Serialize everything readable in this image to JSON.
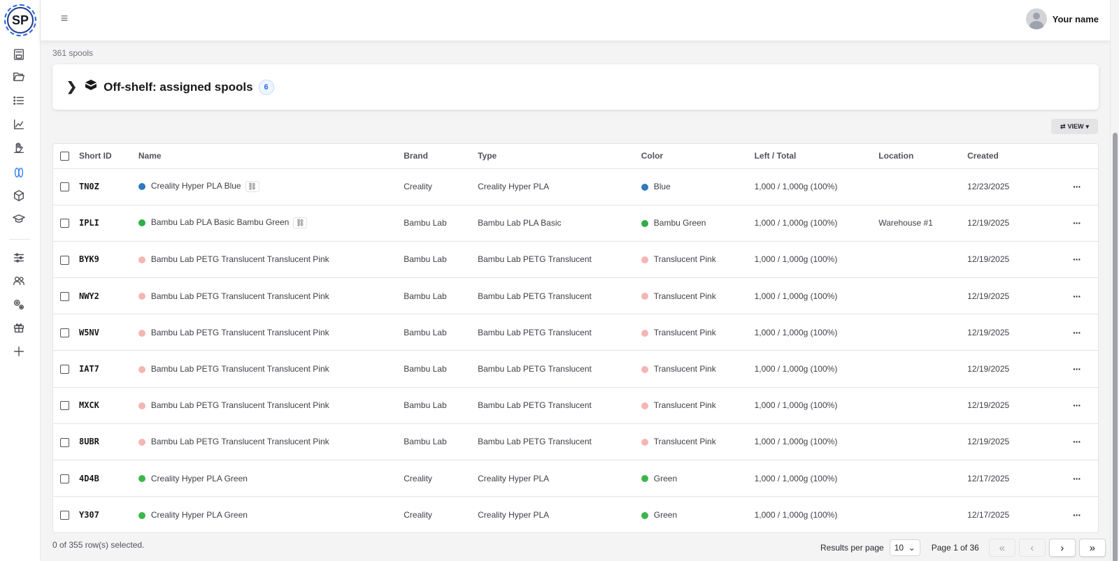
{
  "app": {
    "logo_text": "SP"
  },
  "header": {
    "user_name": "Your name"
  },
  "summary": {
    "spool_count": "361 spools"
  },
  "offshelf": {
    "title": "Off-shelf: assigned spools",
    "count": "6"
  },
  "toolbar": {
    "view_label": "VIEW"
  },
  "table": {
    "columns": [
      "Short ID",
      "Name",
      "Brand",
      "Type",
      "Color",
      "Left / Total",
      "Location",
      "Created"
    ],
    "rows": [
      {
        "id": "TN0Z",
        "name": "Creality Hyper PLA Blue",
        "linked": true,
        "brand": "Creality",
        "type": "Creality Hyper PLA",
        "color": "Blue",
        "color_hex": "#2f7ac0",
        "left_total": "1,000 / 1,000g (100%)",
        "location": "",
        "created": "12/23/2025"
      },
      {
        "id": "IPLI",
        "name": "Bambu Lab PLA Basic Bambu Green",
        "linked": true,
        "brand": "Bambu Lab",
        "type": "Bambu Lab PLA Basic",
        "color": "Bambu Green",
        "color_hex": "#2fae4a",
        "left_total": "1,000 / 1,000g (100%)",
        "location": "Warehouse #1",
        "created": "12/19/2025"
      },
      {
        "id": "BYK9",
        "name": "Bambu Lab PETG Translucent Translucent Pink",
        "linked": false,
        "brand": "Bambu Lab",
        "type": "Bambu Lab PETG Translucent",
        "color": "Translucent Pink",
        "color_hex": "#f4b6b3",
        "left_total": "1,000 / 1,000g (100%)",
        "location": "",
        "created": "12/19/2025"
      },
      {
        "id": "NWY2",
        "name": "Bambu Lab PETG Translucent Translucent Pink",
        "linked": false,
        "brand": "Bambu Lab",
        "type": "Bambu Lab PETG Translucent",
        "color": "Translucent Pink",
        "color_hex": "#f4b6b3",
        "left_total": "1,000 / 1,000g (100%)",
        "location": "",
        "created": "12/19/2025"
      },
      {
        "id": "W5NV",
        "name": "Bambu Lab PETG Translucent Translucent Pink",
        "linked": false,
        "brand": "Bambu Lab",
        "type": "Bambu Lab PETG Translucent",
        "color": "Translucent Pink",
        "color_hex": "#f4b6b3",
        "left_total": "1,000 / 1,000g (100%)",
        "location": "",
        "created": "12/19/2025"
      },
      {
        "id": "IAT7",
        "name": "Bambu Lab PETG Translucent Translucent Pink",
        "linked": false,
        "brand": "Bambu Lab",
        "type": "Bambu Lab PETG Translucent",
        "color": "Translucent Pink",
        "color_hex": "#f4b6b3",
        "left_total": "1,000 / 1,000g (100%)",
        "location": "",
        "created": "12/19/2025"
      },
      {
        "id": "MXCK",
        "name": "Bambu Lab PETG Translucent Translucent Pink",
        "linked": false,
        "brand": "Bambu Lab",
        "type": "Bambu Lab PETG Translucent",
        "color": "Translucent Pink",
        "color_hex": "#f4b6b3",
        "left_total": "1,000 / 1,000g (100%)",
        "location": "",
        "created": "12/19/2025"
      },
      {
        "id": "8UBR",
        "name": "Bambu Lab PETG Translucent Translucent Pink",
        "linked": false,
        "brand": "Bambu Lab",
        "type": "Bambu Lab PETG Translucent",
        "color": "Translucent Pink",
        "color_hex": "#f4b6b3",
        "left_total": "1,000 / 1,000g (100%)",
        "location": "",
        "created": "12/19/2025"
      },
      {
        "id": "4D4B",
        "name": "Creality Hyper PLA Green",
        "linked": false,
        "brand": "Creality",
        "type": "Creality Hyper PLA",
        "color": "Green",
        "color_hex": "#3cb64a",
        "left_total": "1,000 / 1,000g (100%)",
        "location": "",
        "created": "12/17/2025"
      },
      {
        "id": "Y307",
        "name": "Creality Hyper PLA Green",
        "linked": false,
        "brand": "Creality",
        "type": "Creality Hyper PLA",
        "color": "Green",
        "color_hex": "#3cb64a",
        "left_total": "1,000 / 1,000g (100%)",
        "location": "",
        "created": "12/17/2025"
      }
    ]
  },
  "footer": {
    "selected": "0 of 355 row(s) selected.",
    "results_per_page_label": "Results per page",
    "results_per_page_value": "10",
    "page_info": "Page 1 of 36"
  },
  "icons": {
    "sidebar": [
      "printer-icon",
      "folder-icon",
      "list-icon",
      "chart-icon",
      "hand-icon",
      "spool-icon",
      "box-icon",
      "graduation-cap-icon",
      "sliders-icon",
      "users-icon",
      "settings-icon",
      "gift-icon",
      "plus-icon"
    ]
  },
  "colors": {
    "accent": "#3b82f6",
    "badge": "#2563eb"
  }
}
